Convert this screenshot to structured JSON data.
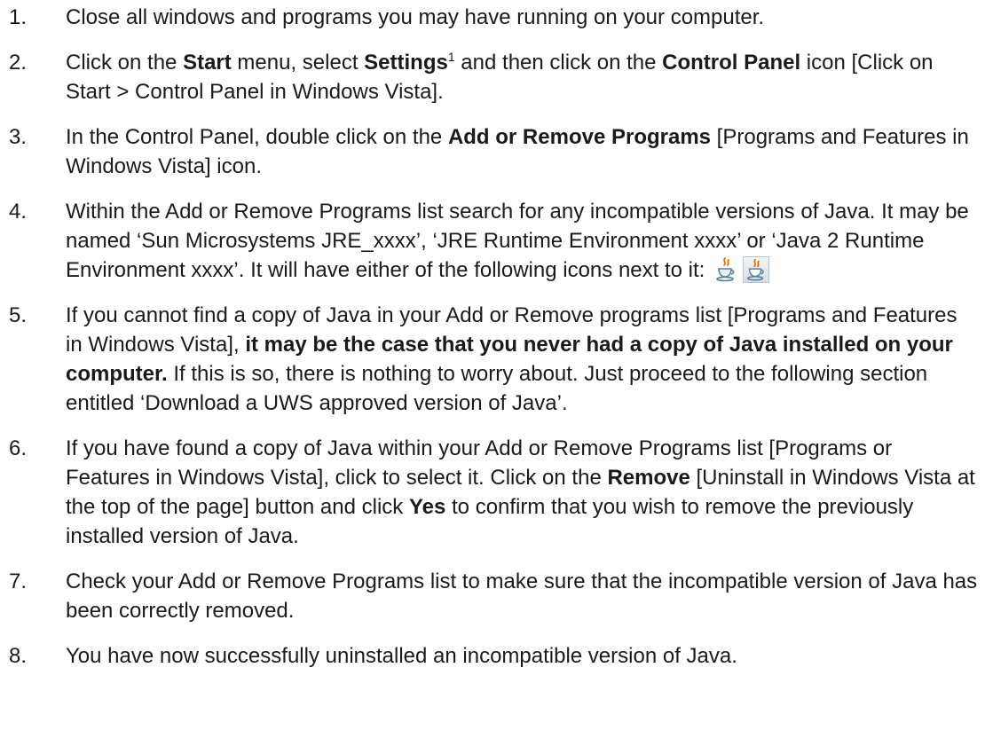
{
  "steps": [
    {
      "number": "1.",
      "text": "Close all windows and programs you may have running on your computer."
    },
    {
      "number": "2.",
      "t1": "Click on the ",
      "b1": "Start",
      "t2": " menu, select ",
      "b2": "Settings",
      "footnote": "1",
      "t3": " and then click on the ",
      "b3": "Control Panel",
      "t4": " icon [Click on Start > Control Panel in Windows Vista]."
    },
    {
      "number": "3.",
      "t1": "In the Control Panel, double click on the ",
      "b1": "Add or Remove Programs",
      "t2": " [Programs and Features in Windows Vista] icon."
    },
    {
      "number": "4.",
      "text": "Within the Add or Remove Programs list search for any incompatible versions of Java. It may be named ‘Sun Microsystems JRE_xxxx’, ‘JRE Runtime Environment xxxx’ or ‘Java 2 Runtime Environment xxxx’. It will have either of the following icons next to it: ",
      "icons": [
        "java-cup-icon",
        "java-cup-framed-icon"
      ]
    },
    {
      "number": "5.",
      "t1": "If you cannot find a copy of Java in your Add or Remove programs list [Programs and Features in Windows Vista], ",
      "b1": "it may be the case that you never had a copy of Java installed on your computer.",
      "t2": " If this is so, there is nothing to worry about. Just proceed to the following section entitled ‘Download a UWS approved version of Java’."
    },
    {
      "number": "6.",
      "t1": "If you have found a copy of Java within your Add or Remove Programs list [Programs or Features in Windows Vista], click to select it. Click on the ",
      "b1": "Remove",
      "t2": " [Uninstall in Windows Vista at the top of the page] button and click ",
      "b2": "Yes",
      "t3": " to confirm that you wish to remove the previously installed version of Java."
    },
    {
      "number": "7.",
      "text": "Check your Add or Remove Programs list to make sure that the incompatible version of Java has been correctly removed."
    },
    {
      "number": "8.",
      "text": "You have now successfully uninstalled an incompatible version of Java."
    }
  ]
}
